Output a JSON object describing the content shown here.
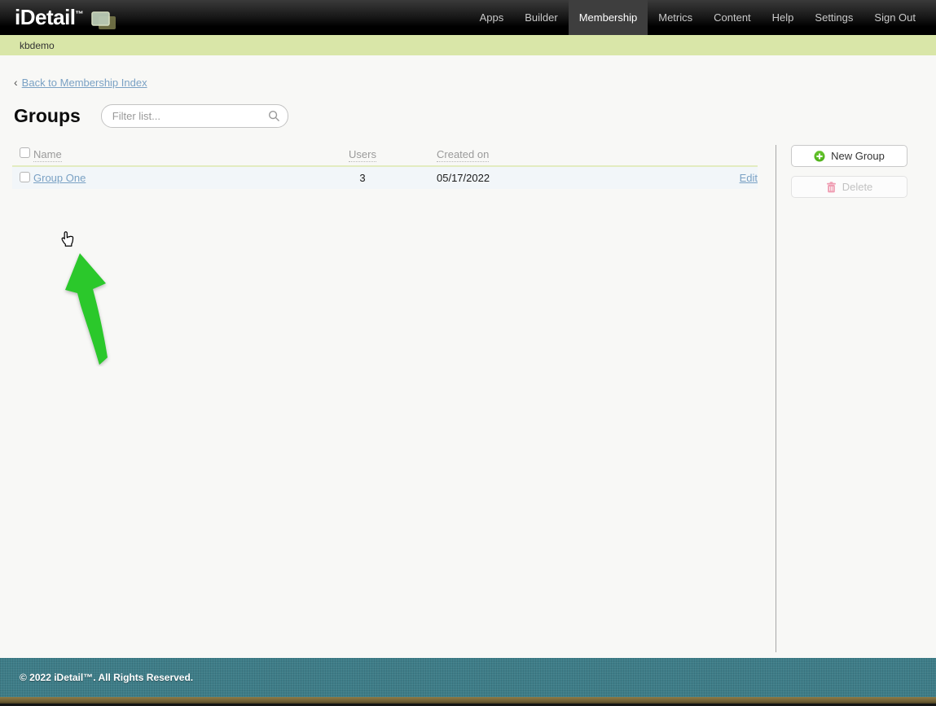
{
  "nav": {
    "logo_text": "iDetail",
    "logo_tm": "™",
    "items": [
      {
        "label": "Apps",
        "active": false
      },
      {
        "label": "Builder",
        "active": false
      },
      {
        "label": "Membership",
        "active": true
      },
      {
        "label": "Metrics",
        "active": false
      },
      {
        "label": "Content",
        "active": false
      },
      {
        "label": "Help",
        "active": false
      },
      {
        "label": "Settings",
        "active": false
      },
      {
        "label": "Sign Out",
        "active": false
      }
    ]
  },
  "subheader": {
    "account": "kbdemo"
  },
  "page": {
    "back_chevron": "‹",
    "back_link": "Back to Membership Index",
    "title": "Groups",
    "filter_placeholder": "Filter list..."
  },
  "table": {
    "headers": {
      "name": "Name",
      "users": "Users",
      "created": "Created on"
    },
    "rows": [
      {
        "name": "Group One",
        "users": "3",
        "created": "05/17/2022",
        "edit": "Edit"
      }
    ]
  },
  "actions": {
    "new_group": "New Group",
    "delete": "Delete"
  },
  "footer": {
    "copyright": "© 2022 iDetail™.  All Rights Reserved."
  },
  "colors": {
    "subheader_green": "#d9e6a8",
    "link_blue": "#7aa1c4",
    "arrow_green": "#2bc82b",
    "footer_teal": "#3e7d88",
    "new_group_icon_green": "#52b41e",
    "delete_icon_pink": "#ef9db2",
    "header_separator": "#e3ecc0"
  }
}
